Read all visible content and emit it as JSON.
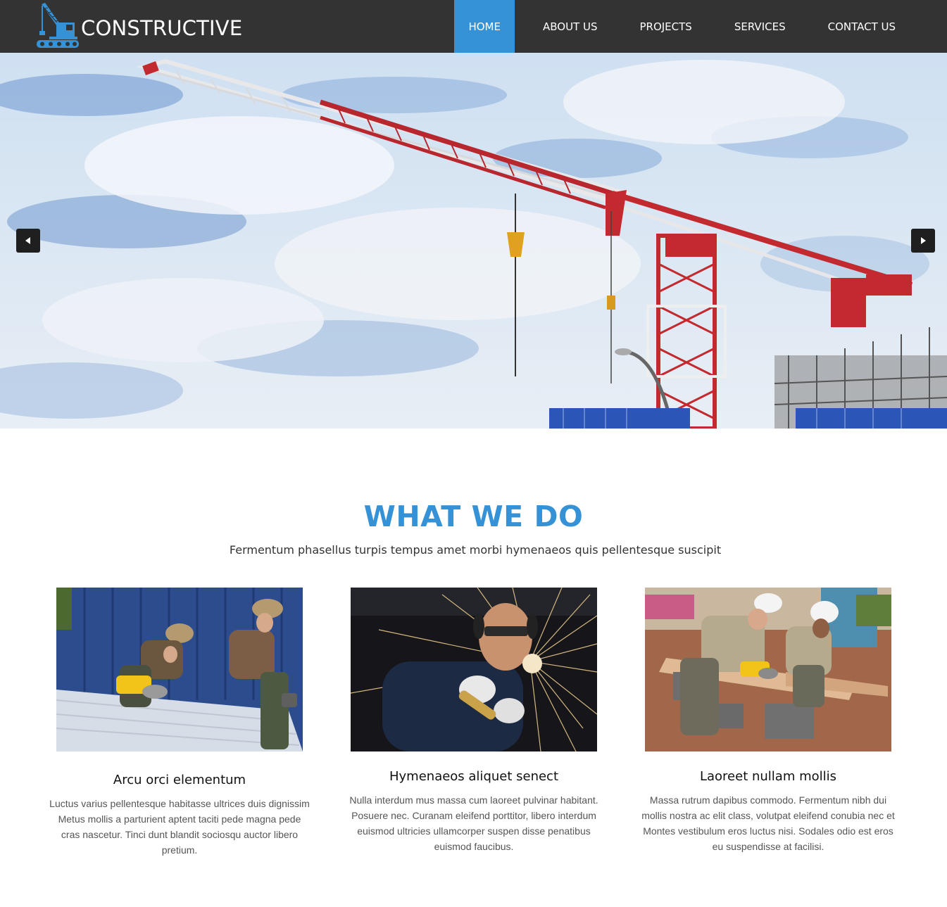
{
  "brand": {
    "name": "CONSTRUCTIVE",
    "accent_color": "#3592d7",
    "header_color": "#333333",
    "logo_icon": "crane-icon"
  },
  "nav": {
    "items": [
      {
        "label": "HOME",
        "active": true
      },
      {
        "label": "ABOUT US",
        "active": false
      },
      {
        "label": "PROJECTS",
        "active": false
      },
      {
        "label": "SERVICES",
        "active": false
      },
      {
        "label": "CONTACT US",
        "active": false
      }
    ]
  },
  "hero": {
    "image": "tower-crane-photo",
    "prev_icon": "arrow-left-icon",
    "next_icon": "arrow-right-icon"
  },
  "section": {
    "title": "WHAT WE DO",
    "subtitle": "Fermentum phasellus turpis tempus amet morbi hymenaeos quis pellentesque suscipit"
  },
  "cards": [
    {
      "image": "workers-cutting-roof-sheet-photo",
      "title": "Arcu orci elementum",
      "text": "Luctus varius pellentesque habitasse ultrices duis dignissim Metus mollis a parturient aptent taciti pede magna pede cras nascetur. Tinci dunt blandit sociosqu auctor libero pretium."
    },
    {
      "image": "welder-grinding-sparks-photo",
      "title": "Hymenaeos aliquet senect",
      "text": "Nulla interdum mus massa cum laoreet pulvinar habitant. Posuere nec. Curanam eleifend porttitor, libero interdum euismod ultricies ullamcorper suspen disse penatibus euismod faucibus."
    },
    {
      "image": "workers-cutting-plank-photo",
      "title": "Laoreet nullam mollis",
      "text": "Massa rutrum dapibus commodo. Fermentum nibh dui mollis nostra ac elit class, volutpat eleifend conubia nec et Montes vestibulum eros luctus nisi. Sodales odio est eros eu suspendisse at facilisi."
    }
  ]
}
